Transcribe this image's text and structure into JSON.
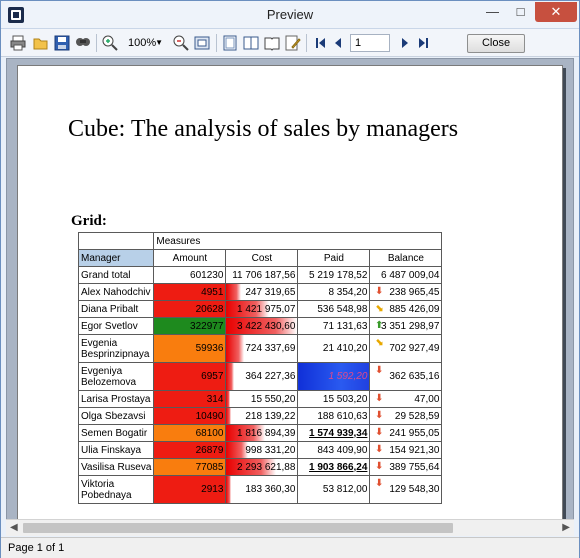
{
  "window": {
    "title": "Preview"
  },
  "toolbar": {
    "zoom": "100%",
    "page_number": "1",
    "close_label": "Close",
    "icons": [
      "print-icon",
      "open-icon",
      "save-icon",
      "find-icon",
      "zoom-in-icon",
      "zoom-out-icon",
      "fit-page-icon",
      "page-setup-icon",
      "multi-page-icon",
      "book-icon",
      "edit-icon",
      "first-page-icon",
      "prev-page-icon",
      "next-page-icon",
      "last-page-icon"
    ]
  },
  "report": {
    "title": "Cube: The analysis of sales by managers",
    "grid_label": "Grid:",
    "measures_label": "Measures",
    "columns": [
      "Manager",
      "Amount",
      "Cost",
      "Paid",
      "Balance"
    ],
    "rows": [
      {
        "manager": "Grand total",
        "amount": "601230",
        "cost": "11 706 187,56",
        "paid": "5 219 178,52",
        "balance": "6 487 009,04",
        "trend": "",
        "amount_color": "#ffffff",
        "cost_fill": 0.0,
        "tall": false
      },
      {
        "manager": "Alex Nahodchiv",
        "amount": "4951",
        "cost": "247 319,65",
        "paid": "8 354,20",
        "balance": "238 965,45",
        "trend": "down",
        "amount_color": "#ee1c12",
        "cost_fill": 0.2,
        "tall": false
      },
      {
        "manager": "Diana Pribalt",
        "amount": "20628",
        "cost": "1 421 975,07",
        "paid": "536 548,98",
        "balance": "885 426,09",
        "trend": "side",
        "amount_color": "#ee1c12",
        "cost_fill": 0.6,
        "tall": false
      },
      {
        "manager": "Egor Svetlov",
        "amount": "322977",
        "cost": "3 422 430,60",
        "paid": "71 131,63",
        "balance": "3 351 298,97",
        "trend": "up",
        "amount_color": "#1e8a1e",
        "cost_fill": 1.0,
        "tall": false
      },
      {
        "manager": "Evgenia Besprinzipnaya",
        "amount": "59936",
        "cost": "724 337,69",
        "paid": "21 410,20",
        "balance": "702 927,49",
        "trend": "side",
        "amount_color": "#f97d0e",
        "cost_fill": 0.25,
        "tall": true
      },
      {
        "manager": "Evgeniya Belozemova",
        "amount": "6957",
        "cost": "364 227,36",
        "paid": "1 592,20",
        "balance": "362 635,16",
        "trend": "down",
        "amount_color": "#ee1c12",
        "cost_fill": 0.1,
        "tall": true,
        "paid_highlight": true
      },
      {
        "manager": "Larisa Prostaya",
        "amount": "314",
        "cost": "15 550,20",
        "paid": "15 503,20",
        "balance": "47,00",
        "trend": "down",
        "amount_color": "#ee1c12",
        "cost_fill": 0.05,
        "tall": false
      },
      {
        "manager": "Olga Sbezavsi",
        "amount": "10490",
        "cost": "218 139,22",
        "paid": "188 610,63",
        "balance": "29 528,59",
        "trend": "down",
        "amount_color": "#ee1c12",
        "cost_fill": 0.07,
        "tall": false
      },
      {
        "manager": "Semen Bogatir",
        "amount": "68100",
        "cost": "1 816 894,39",
        "paid": "1 574 939,34",
        "balance": "241 955,05",
        "trend": "down",
        "amount_color": "#f97d0e",
        "cost_fill": 0.55,
        "tall": false,
        "paid_bold": true
      },
      {
        "manager": "Ulia Finskaya",
        "amount": "26879",
        "cost": "998 331,20",
        "paid": "843 409,90",
        "balance": "154 921,30",
        "trend": "down",
        "amount_color": "#ee1c12",
        "cost_fill": 0.3,
        "tall": false
      },
      {
        "manager": "Vasilisa Ruseva",
        "amount": "77085",
        "cost": "2 293 621,88",
        "paid": "1 903 866,24",
        "balance": "389 755,64",
        "trend": "down",
        "amount_color": "#f97d0e",
        "cost_fill": 0.7,
        "tall": false,
        "paid_bold": true
      },
      {
        "manager": "Viktoria Pobednaya",
        "amount": "2913",
        "cost": "183 360,30",
        "paid": "53 812,00",
        "balance": "129 548,30",
        "trend": "down",
        "amount_color": "#ee1c12",
        "cost_fill": 0.06,
        "tall": true
      }
    ]
  },
  "status": {
    "page_info": "Page 1 of 1"
  }
}
